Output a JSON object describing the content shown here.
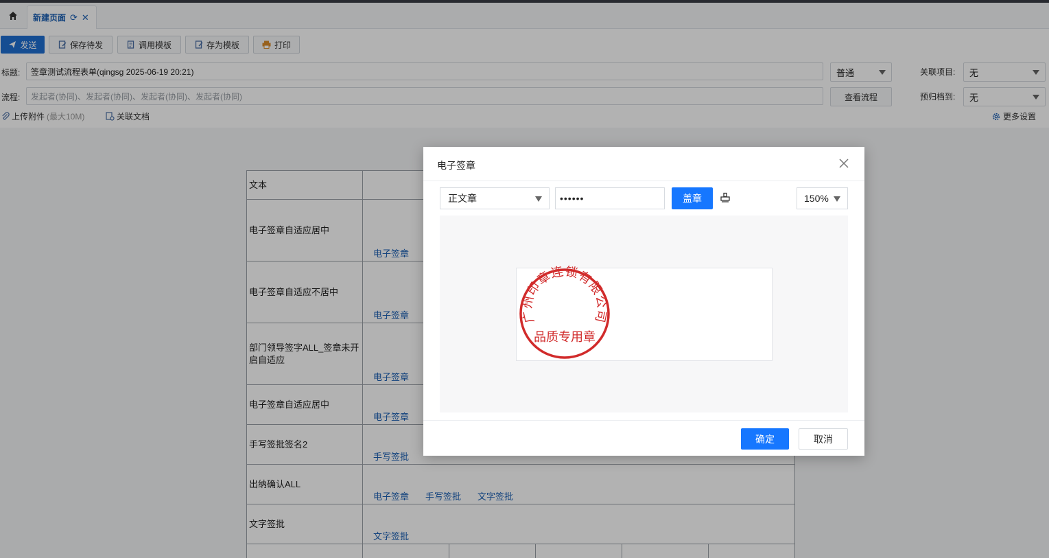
{
  "tabs": [
    {
      "label": "新建页面"
    }
  ],
  "toolbar": {
    "send": "发送",
    "save_pending": "保存待发",
    "use_template": "调用模板",
    "save_as_template": "存为模板",
    "print": "打印"
  },
  "form_header": {
    "title_label": "标题:",
    "title_value": "签章测试流程表单(qingsg 2025-06-19 20:21)",
    "priority": "普通",
    "related_project_label": "关联项目:",
    "related_project_value": "无",
    "flow_label": "流程:",
    "flow_placeholder": "发起者(协同)、发起者(协同)、发起者(协同)、发起者(协同)",
    "view_flow": "查看流程",
    "archive_label": "预归档到:",
    "archive_value": "无",
    "upload_attachment": "上传附件",
    "upload_limit": "(最大10M)",
    "related_docs": "关联文档",
    "more_settings": "更多设置"
  },
  "form_rows": [
    {
      "label": "文本",
      "links": []
    },
    {
      "label": "电子签章自适应居中",
      "links": [
        "电子签章"
      ]
    },
    {
      "label": "电子签章自适应不居中",
      "links": [
        "电子签章"
      ]
    },
    {
      "label": "部门领导签字ALL_签章未开启自适应",
      "links": [
        "电子签章"
      ]
    },
    {
      "label": "电子签章自适应居中",
      "links": [
        "电子签章"
      ]
    },
    {
      "label": "手写签批签名2",
      "links": [
        "手写签批"
      ]
    },
    {
      "label": "出纳确认ALL",
      "links": [
        "电子签章",
        "手写签批",
        "文字签批"
      ]
    },
    {
      "label": "文字签批",
      "links": [
        "文字签批"
      ]
    }
  ],
  "dialog": {
    "title": "电子签章",
    "seal_type": "正文章",
    "password": "••••••",
    "stamp_button": "盖章",
    "zoom": "150%",
    "seal_text_ring": "广州印章连锁有限公司",
    "seal_text_center": "品质专用章",
    "seal_color": "#d12b2b",
    "confirm": "确定",
    "cancel": "取消"
  }
}
